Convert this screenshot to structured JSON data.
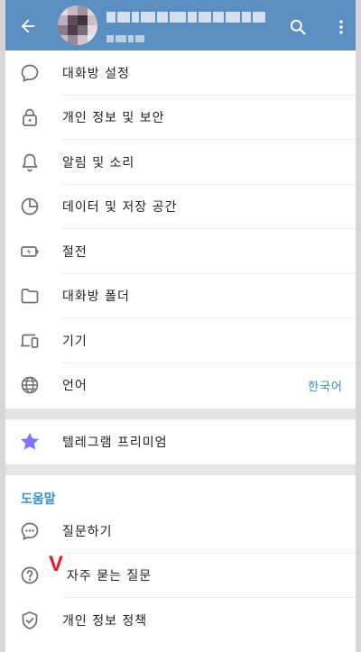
{
  "header": {
    "back_icon": "arrow-left-icon",
    "search_icon": "search-icon",
    "more_icon": "more-vertical-icon",
    "background": "#5b8ec1"
  },
  "settings": {
    "items": [
      {
        "label": "대화방 설정",
        "icon": "chat-bubble-icon"
      },
      {
        "label": "개인 정보 및 보안",
        "icon": "lock-icon"
      },
      {
        "label": "알림 및 소리",
        "icon": "bell-icon"
      },
      {
        "label": "데이터 및 저장 공간",
        "icon": "pie-clock-icon"
      },
      {
        "label": "절전",
        "icon": "battery-icon"
      },
      {
        "label": "대화방 폴더",
        "icon": "folder-icon"
      },
      {
        "label": "기기",
        "icon": "devices-icon"
      },
      {
        "label": "언어",
        "icon": "globe-icon",
        "value": "한국어"
      }
    ]
  },
  "premium": {
    "label": "텔레그램 프리미엄",
    "icon": "star-icon",
    "color": "#7b61ff"
  },
  "help": {
    "title": "도움말",
    "items": [
      {
        "label": "질문하기",
        "icon": "chat-dots-icon"
      },
      {
        "label": "자주 묻는 질문",
        "icon": "question-circle-icon"
      },
      {
        "label": "개인 정보 정책",
        "icon": "shield-check-icon"
      }
    ],
    "annotation": "V"
  },
  "colors": {
    "accent": "#3b87c8",
    "annotation": "#e02020"
  }
}
